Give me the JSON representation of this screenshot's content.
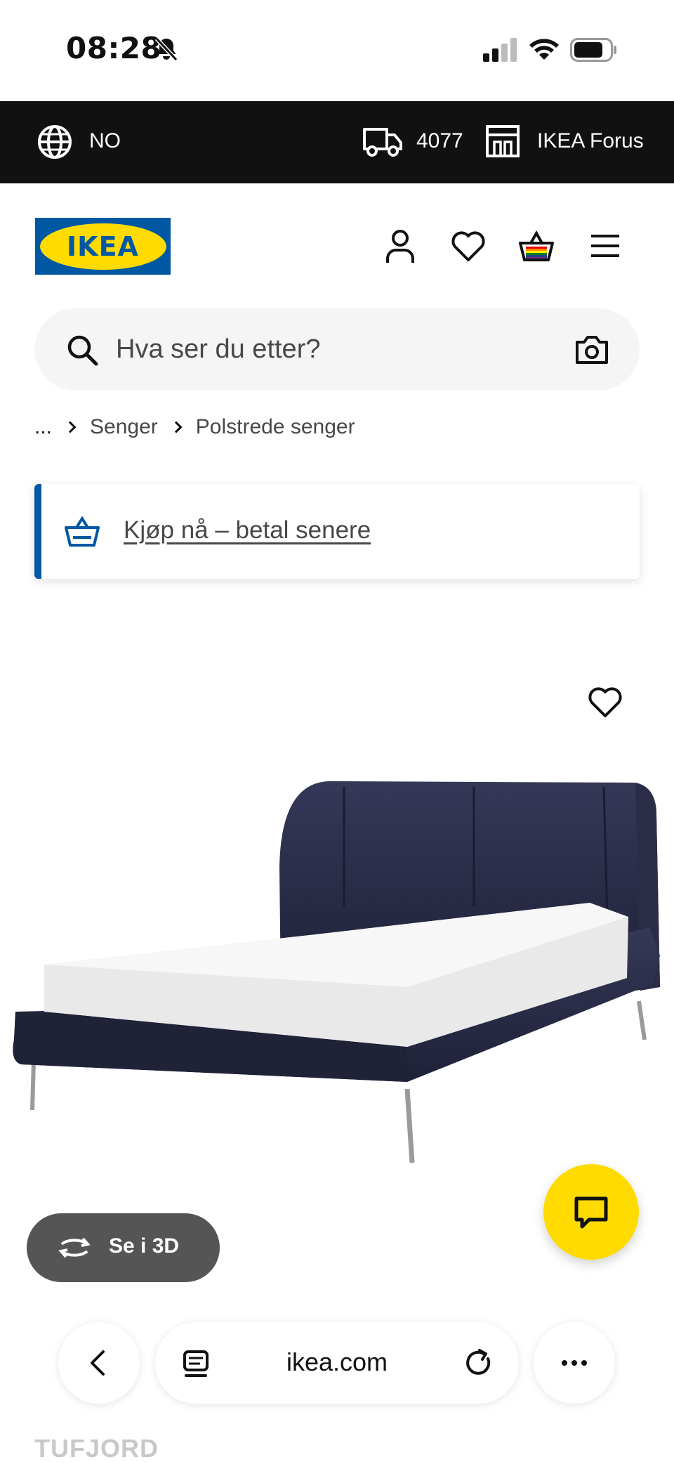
{
  "status_bar": {
    "time": "08:28",
    "icons": [
      "bell-off-icon",
      "signal-icon",
      "wifi-icon",
      "battery-icon"
    ]
  },
  "top_bar": {
    "language": "NO",
    "postcode": "4077",
    "store": "IKEA Forus",
    "icons": [
      "globe-icon",
      "truck-icon",
      "store-icon"
    ]
  },
  "header": {
    "logo_text": "IKEA",
    "icons": [
      "profile-icon",
      "heart-icon",
      "basket-icon",
      "menu-icon"
    ]
  },
  "search": {
    "placeholder": "Hva ser du etter?",
    "icons": [
      "search-icon",
      "camera-icon"
    ]
  },
  "breadcrumb": {
    "items": [
      "...",
      "Senger",
      "Polstrede senger"
    ]
  },
  "financing": {
    "label": "Kjøp nå – betal senere"
  },
  "product": {
    "name": "TUFJORD",
    "view_3d_label": "Se i 3D"
  },
  "browser": {
    "url": "ikea.com",
    "icons": [
      "back-icon",
      "tabs-icon",
      "reload-icon",
      "more-icon"
    ]
  },
  "colors": {
    "ikea_blue": "#0058a3",
    "ikea_yellow": "#ffdb00",
    "top_bar": "#111111",
    "bed_fabric": "#2a2c4a"
  }
}
